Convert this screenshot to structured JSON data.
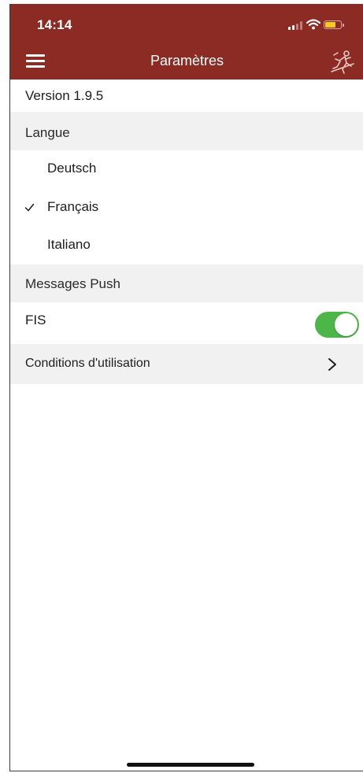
{
  "status_bar": {
    "time": "14:14",
    "icons": [
      "signal-icon",
      "wifi-icon",
      "battery-icon"
    ],
    "battery_color": "#f5cc1b"
  },
  "nav_bar": {
    "title": "Paramètres",
    "menu_icon": "hamburger-menu-icon",
    "logo_icon": "swiss-ski-logo-icon",
    "background_color": "#8b2b23"
  },
  "version": {
    "label": "Version 1.9.5"
  },
  "language_section": {
    "header": "Langue",
    "items": [
      {
        "label": "Deutsch",
        "selected": false
      },
      {
        "label": "Français",
        "selected": true
      },
      {
        "label": "Italiano",
        "selected": false
      }
    ]
  },
  "push_section": {
    "header": "Messages Push",
    "items": [
      {
        "label": "FIS",
        "enabled": true,
        "toggle_color": "#4cb648"
      }
    ]
  },
  "conditions": {
    "label": "Conditions d'utilisation",
    "icon": "chevron-right-icon"
  }
}
